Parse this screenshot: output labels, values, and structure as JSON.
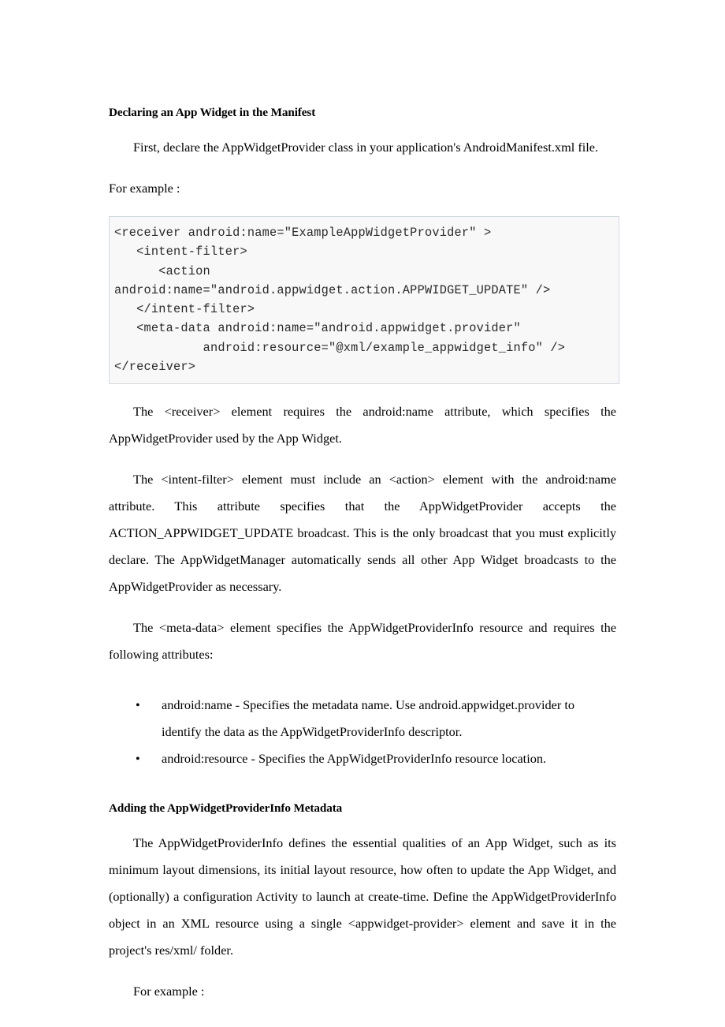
{
  "document": {
    "section_one": {
      "heading": "Declaring an App Widget in the Manifest",
      "intro_paragraph": "First, declare the AppWidgetProvider class in your application's AndroidManifest.xml file.",
      "for_example_label": "For example :",
      "code_sample": "<receiver android:name=\"ExampleAppWidgetProvider\" >\n   <intent-filter>\n      <action\nandroid:name=\"android.appwidget.action.APPWIDGET_UPDATE\" />\n   </intent-filter>\n   <meta-data android:name=\"android.appwidget.provider\"\n            android:resource=\"@xml/example_appwidget_info\" />\n</receiver>",
      "paragraph_receiver": "The <receiver> element requires the android:name attribute, which specifies the AppWidgetProvider used by the App Widget.",
      "paragraph_intent_filter": "The <intent-filter> element must include an <action> element with the android:name attribute. This attribute specifies that the AppWidgetProvider accepts the ACTION_APPWIDGET_UPDATE broadcast. This is the only broadcast that you must explicitly declare. The AppWidgetManager automatically sends all other App Widget broadcasts to the AppWidgetProvider as necessary.",
      "paragraph_meta_data": "The <meta-data> element specifies the AppWidgetProviderInfo resource and requires the following attributes:",
      "bullet_marker": "•",
      "bullets": [
        "android:name - Specifies the metadata name. Use android.appwidget.provider to identify the data as the AppWidgetProviderInfo descriptor.",
        "android:resource - Specifies the AppWidgetProviderInfo resource location."
      ]
    },
    "section_two": {
      "heading": "Adding the AppWidgetProviderInfo Metadata",
      "paragraph_info": "The AppWidgetProviderInfo defines the essential qualities of an App Widget, such as its minimum layout dimensions, its initial layout resource, how often to update the App Widget, and (optionally) a configuration Activity to launch at create-time. Define the AppWidgetProviderInfo object in an XML resource using a single <appwidget-provider> element and save it in the project's res/xml/ folder.",
      "for_example_label": "For example :"
    }
  }
}
